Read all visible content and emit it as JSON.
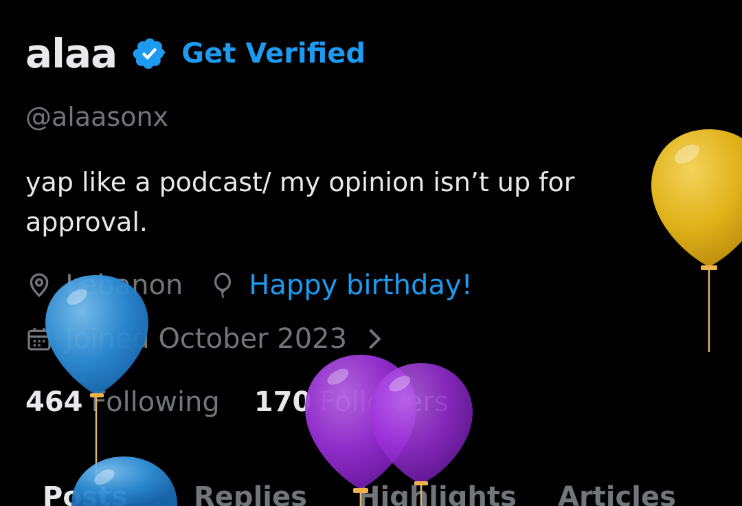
{
  "profile": {
    "display_name": "alaa",
    "get_verified_label": "Get Verified",
    "handle": "@alaasonx",
    "bio": "yap like a podcast/ my opinion isn’t up for approval.",
    "location": "Lebanon",
    "birthday_text": "Happy birthday!",
    "joined": "Joined October 2023"
  },
  "stats": {
    "following_count": "464",
    "following_label": "Following",
    "followers_count": "170",
    "followers_label": "Followers"
  },
  "tabs": [
    {
      "label": "Posts",
      "active": true
    },
    {
      "label": "Replies",
      "active": false
    },
    {
      "label": "Highlights",
      "active": false
    },
    {
      "label": "Articles",
      "active": false
    }
  ],
  "icons": {
    "verified": "verified-badge-icon",
    "location": "location-pin-icon",
    "birthday": "balloon-icon",
    "calendar": "calendar-icon",
    "chevron": "chevron-right-icon"
  },
  "colors": {
    "background": "#000000",
    "text_primary": "#e7e9ea",
    "text_secondary": "#71767b",
    "accent": "#1d9bf0",
    "balloon_blue": "#2f8fd8",
    "balloon_purple": "#9b30d9",
    "balloon_gold": "#e0b21a"
  }
}
